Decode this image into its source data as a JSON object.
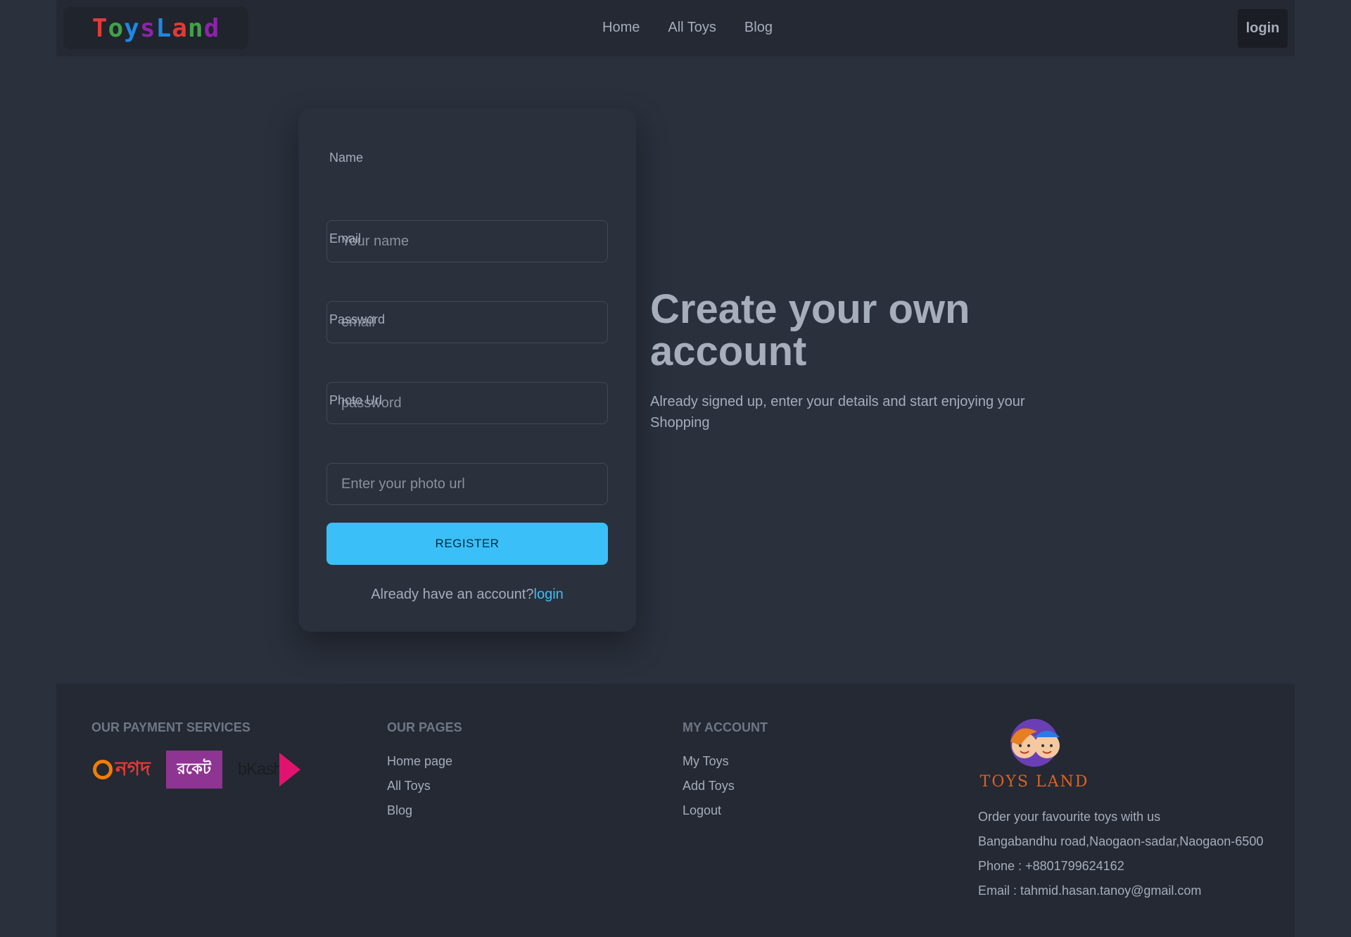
{
  "navbar": {
    "logo_letters": [
      {
        "ch": "T",
        "color": "#e53935"
      },
      {
        "ch": "o",
        "color": "#43a047"
      },
      {
        "ch": "y",
        "color": "#1e88e5"
      },
      {
        "ch": "s",
        "color": "#8e24aa"
      },
      {
        "ch": "L",
        "color": "#1e88e5"
      },
      {
        "ch": "a",
        "color": "#e53935"
      },
      {
        "ch": "n",
        "color": "#43a047"
      },
      {
        "ch": "d",
        "color": "#8e24aa"
      }
    ],
    "links": [
      "Home",
      "All Toys",
      "Blog"
    ],
    "login_label": "login"
  },
  "form": {
    "name_label": "Name",
    "name_placeholder": "Your name",
    "email_label": "Email",
    "email_placeholder": "email",
    "password_label": "Password",
    "password_placeholder": "password",
    "photo_label": "Photo Url",
    "photo_placeholder": "Enter your photo url",
    "register_label": "REGISTER",
    "already_text": "Already have an account?",
    "login_link": "login"
  },
  "hero": {
    "title": "Create your own account",
    "subtitle": "Already signed up, enter your details and start enjoying your Shopping"
  },
  "footer": {
    "payment_title": "OUR PAYMENT SERVICES",
    "payment_logos": [
      "নগদ",
      "রকেট",
      "bKash"
    ],
    "pages_title": "OUR PAGES",
    "pages_links": [
      "Home page",
      "All Toys",
      "Blog"
    ],
    "account_title": "MY ACCOUNT",
    "account_links": [
      "My Toys",
      "Add Toys",
      "Logout"
    ],
    "brand_name": "TOYS LAND",
    "tagline": "Order your favourite toys with us",
    "address": "Bangabandhu road,Naogaon-sadar,Naogaon-6500",
    "phone": "Phone : +8801799624162",
    "email": "Email : tahmid.hasan.tanoy@gmail.com"
  },
  "colors": {
    "accent": "#3abff8",
    "background": "#2a303c",
    "navbar_bg": "#242933",
    "text": "#a6adbb"
  }
}
